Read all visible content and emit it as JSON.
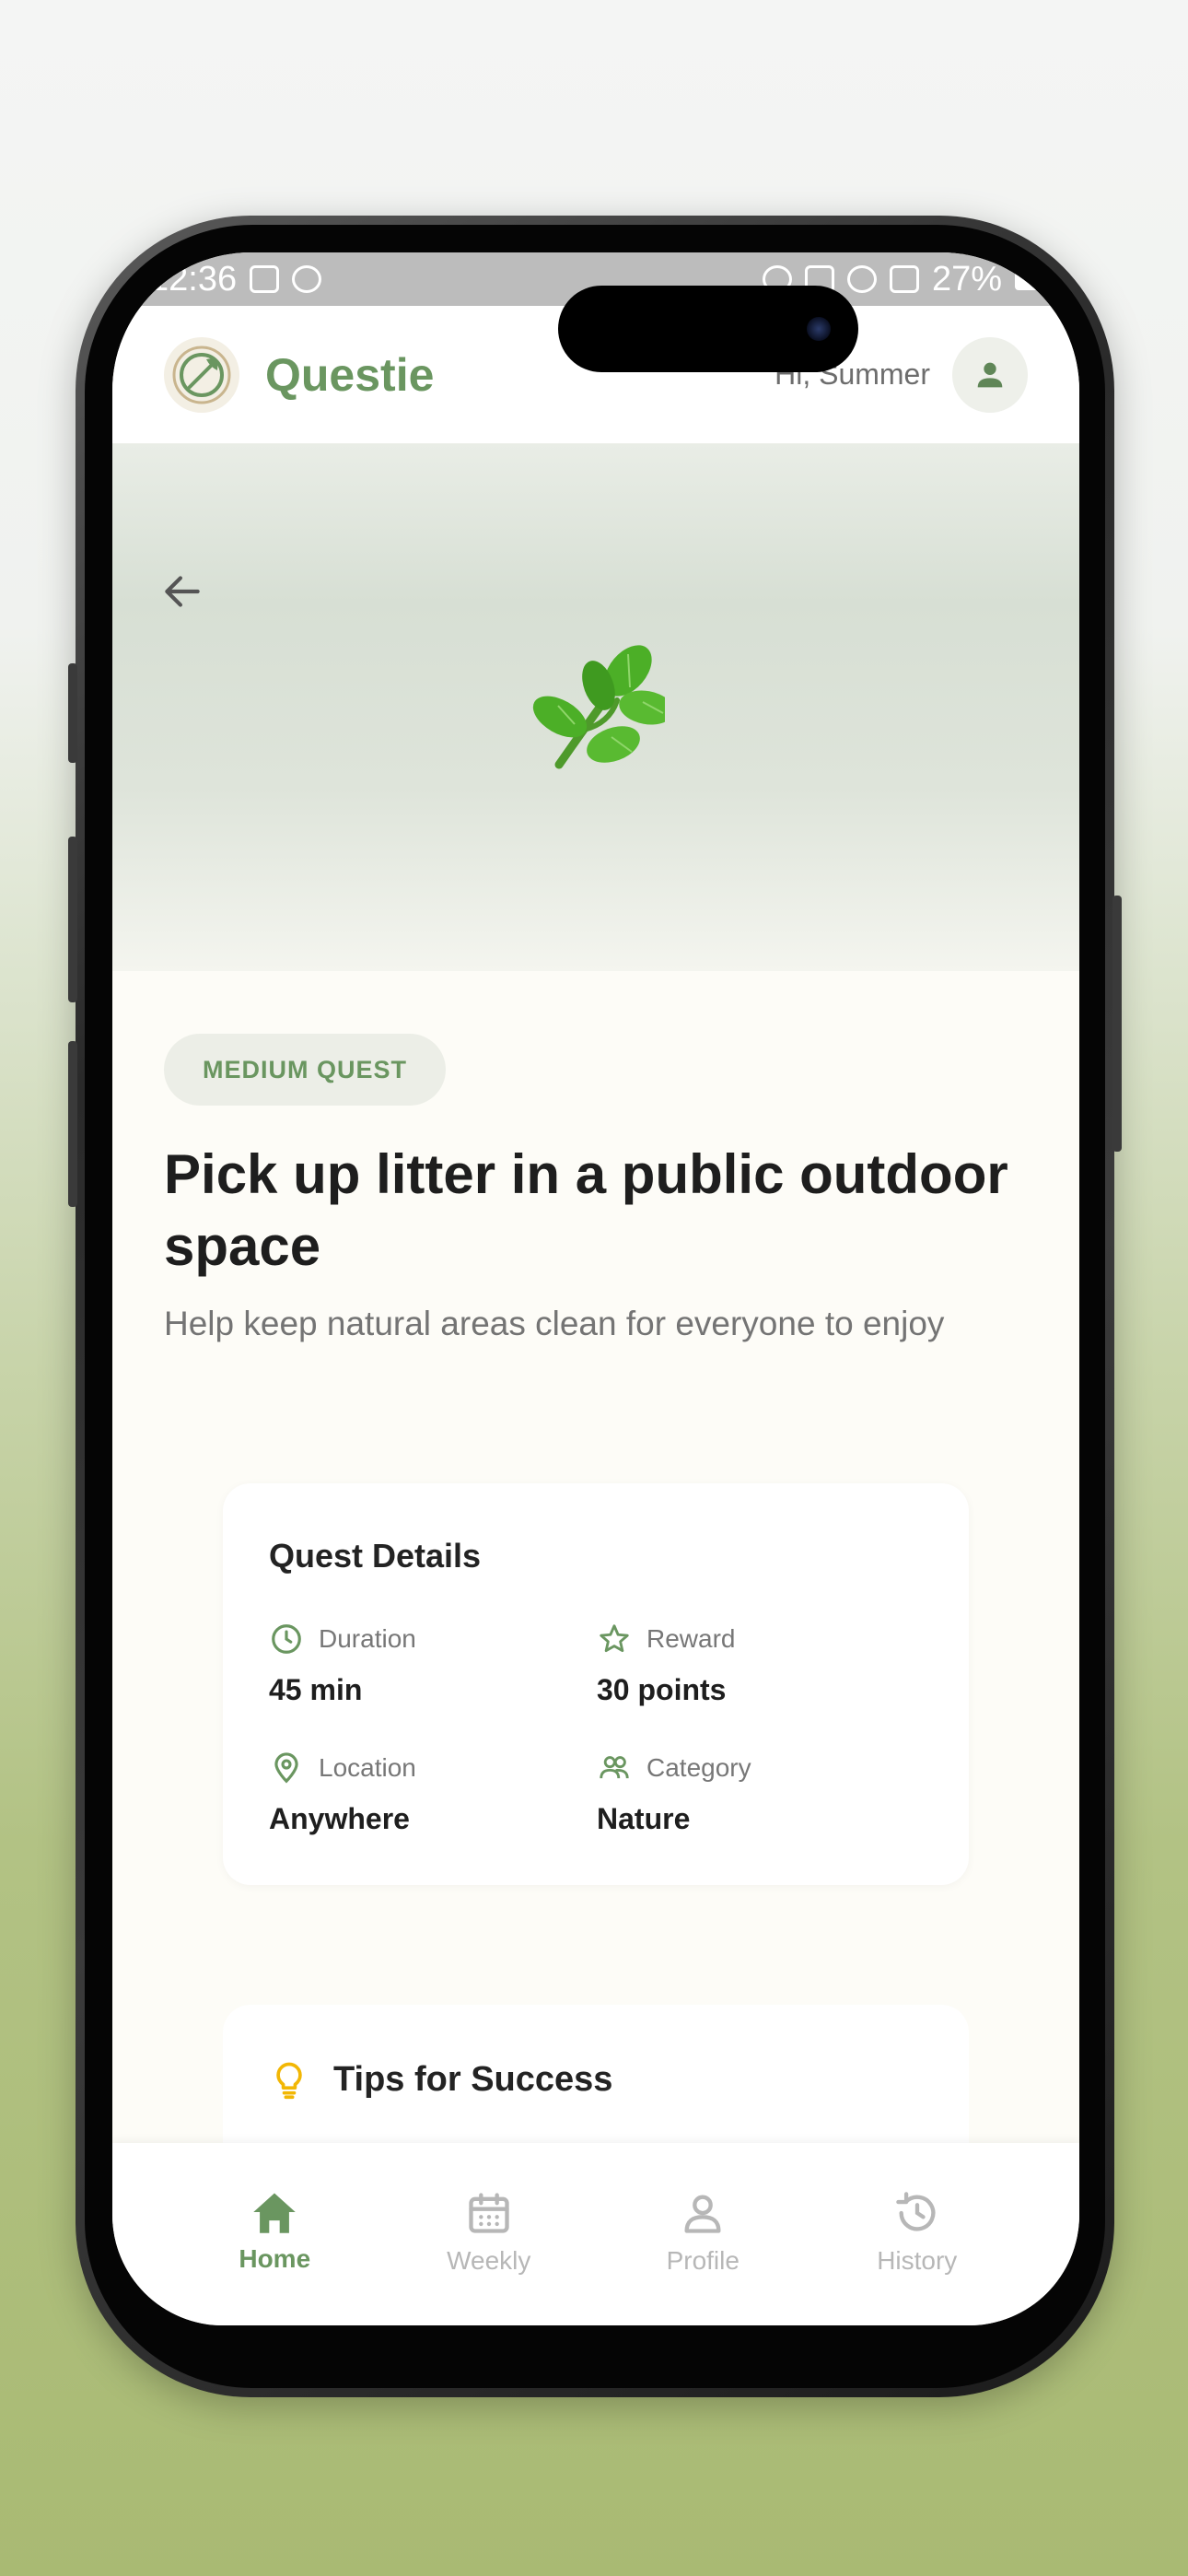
{
  "status_bar": {
    "time": "12:36",
    "battery": "27%"
  },
  "header": {
    "app_name": "Questie",
    "greeting": "Hi, Summer"
  },
  "hero": {
    "emoji": "herb-emoji"
  },
  "quest": {
    "difficulty": "MEDIUM QUEST",
    "title": "Pick up litter in a public outdoor space",
    "description": "Help keep natural areas clean for everyone to enjoy"
  },
  "details": {
    "title": "Quest Details",
    "duration": {
      "label": "Duration",
      "value": "45 min"
    },
    "reward": {
      "label": "Reward",
      "value": "30 points"
    },
    "location": {
      "label": "Location",
      "value": "Anywhere"
    },
    "category": {
      "label": "Category",
      "value": "Nature"
    }
  },
  "tips": {
    "title": "Tips for Success"
  },
  "nav": {
    "items": [
      {
        "label": "Home",
        "icon": "home-icon",
        "active": true
      },
      {
        "label": "Weekly",
        "icon": "calendar-icon",
        "active": false
      },
      {
        "label": "Profile",
        "icon": "person-icon",
        "active": false
      },
      {
        "label": "History",
        "icon": "history-icon",
        "active": false
      }
    ]
  },
  "colors": {
    "brand_green": "#6a9660",
    "tip_icon": "#f2b705"
  }
}
